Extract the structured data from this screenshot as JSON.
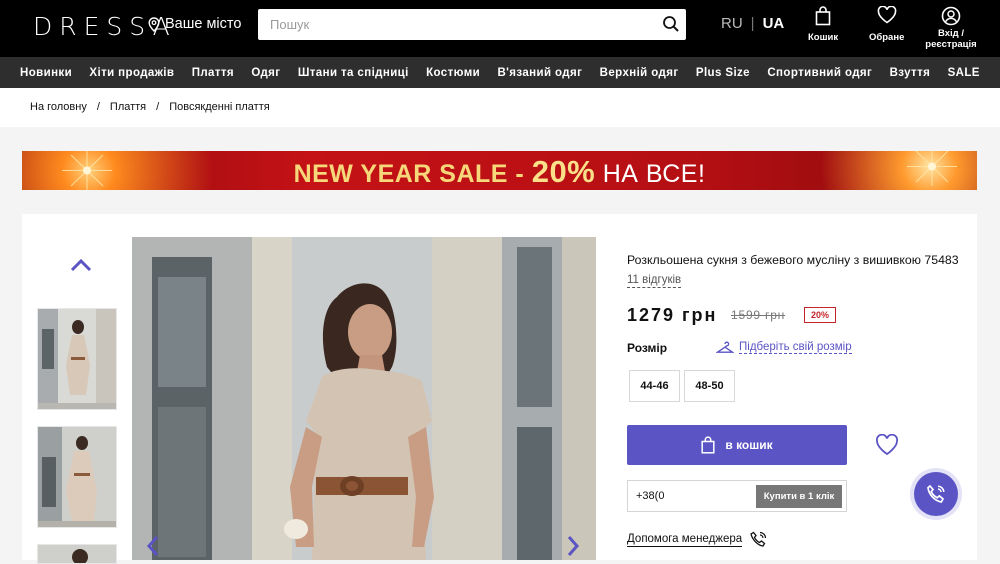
{
  "header": {
    "logo": "DRESSA",
    "city_label": "Ваше місто",
    "search_placeholder": "Пошук",
    "lang_ru": "RU",
    "lang_sep": "|",
    "lang_ua": "UA",
    "cart_label": "Кошик",
    "favorites_label": "Обране",
    "login_label_line1": "Вхід /",
    "login_label_line2": "реєстрація"
  },
  "nav": {
    "items": [
      "Новинки",
      "Хіти продажів",
      "Плаття",
      "Одяг",
      "Штани та спідниці",
      "Костюми",
      "В'язаний одяг",
      "Верхній одяг",
      "Plus Size",
      "Спортивний одяг",
      "Взуття",
      "SALE"
    ]
  },
  "breadcrumb": {
    "items": [
      "На головну",
      "Плаття",
      "Повсякденні плаття"
    ],
    "separator": "/"
  },
  "banner": {
    "text_main": "NEW YEAR SALE -",
    "text_percent": "20%",
    "text_tail": "НА ВСЕ!"
  },
  "product": {
    "title": "Розкльошена сукня з бежевого мусліну з вишивкою 75483",
    "reviews": "11 відгуків",
    "price": "1279 грн",
    "old_price": "1599 грн",
    "discount": "20%",
    "size_label": "Розмір",
    "size_guide": "Підберіть свій розмір",
    "sizes": [
      "44-46",
      "48-50"
    ],
    "cart_button": "в кошик",
    "phone_prefix": "+38(0",
    "one_click": "Купити в 1 клік",
    "manager_help": "Допомога менеджера"
  },
  "colors": {
    "accent": "#5b54c4",
    "header_bg": "#000000",
    "nav_bg": "#2e2e2e",
    "discount": "#c3252b",
    "banner_red": "#c41216"
  },
  "icons": {
    "location": "location-pin-icon",
    "search": "search-icon",
    "cart": "shopping-bag-icon",
    "favorites": "heart-icon",
    "account": "user-circle-icon",
    "size_guide": "hanger-icon",
    "call": "phone-icon"
  }
}
